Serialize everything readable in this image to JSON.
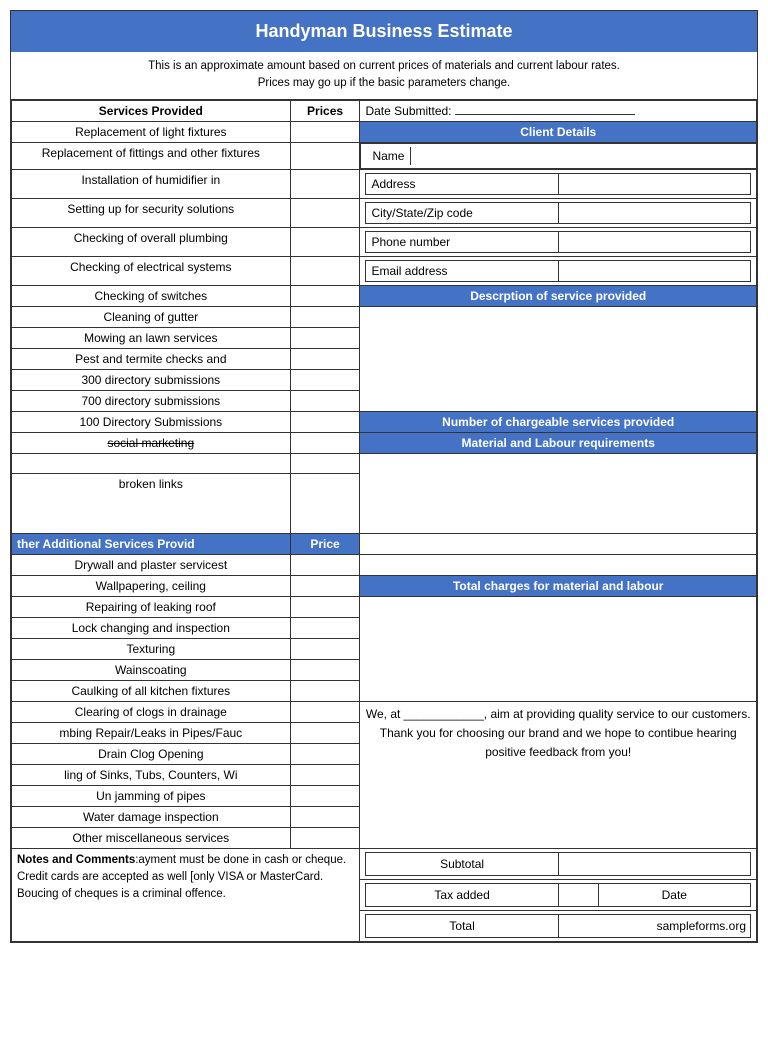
{
  "title": "Handyman Business Estimate",
  "disclaimer": {
    "line1": "This is an approximate amount based on current prices of materials and current labour rates.",
    "line2": "Prices may go up if the basic parameters change."
  },
  "columns": {
    "services": "Services Provided",
    "prices": "Prices",
    "date_label": "Date Submitted:"
  },
  "client_details": {
    "header": "Client Details",
    "fields": [
      "Name",
      "Address",
      "City/State/Zip code",
      "Phone number",
      "Email address"
    ]
  },
  "description_header": "Descrption of service provided",
  "services": [
    "Replacement of light fixtures",
    "Replacement of fittings and other fixtures",
    "Installation of humidifier in",
    "Setting up for security solutions",
    "Checking of overall plumbing",
    "Checking of electrical systems",
    "Checking of switches",
    "Cleaning of gutter",
    "Mowing an lawn services",
    "Pest and termite checks and",
    "300 directory submissions",
    "700 directory submissions",
    "100 Directory Submissions",
    "social marketing",
    "",
    "broken links"
  ],
  "chargeable_header": "Number of chargeable services provided",
  "material_header": "Material and Labour requirements",
  "additional_header": "ther Additional Services Provid",
  "additional_price_header": "Price",
  "additional_services": [
    "Drywall and plaster servicest",
    "Wallpapering, ceiling",
    "Repairing of leaking roof",
    "Lock changing and inspection",
    "Texturing",
    "Wainscoating",
    "Caulking of all kitchen fixtures",
    "Clearing of clogs in drainage",
    "mbing Repair/Leaks in Pipes/Fauc",
    "Drain Clog Opening",
    "ling of Sinks, Tubs, Counters, Wi",
    "Un jamming of pipes",
    "Water damage inspection",
    "Other miscellaneous services"
  ],
  "total_charges_header": "Total charges for material and labour",
  "thank_you": {
    "text": "We, at ____________, aim at providing quality service to our customers. Thank you for choosing our brand and we hope to contibue hearing positive feedback from you!"
  },
  "notes": {
    "label": "Notes and Comments",
    "text": ":ayment must be done in cash or cheque. Credit cards are accepted as well [only VISA or MasterCard. Boucing of cheques is a criminal offence."
  },
  "subtotal_label": "Subtotal",
  "tax_label": "Tax added",
  "date_bottom_label": "Date",
  "total_label": "Total",
  "sampleforms": "sampleforms.org"
}
